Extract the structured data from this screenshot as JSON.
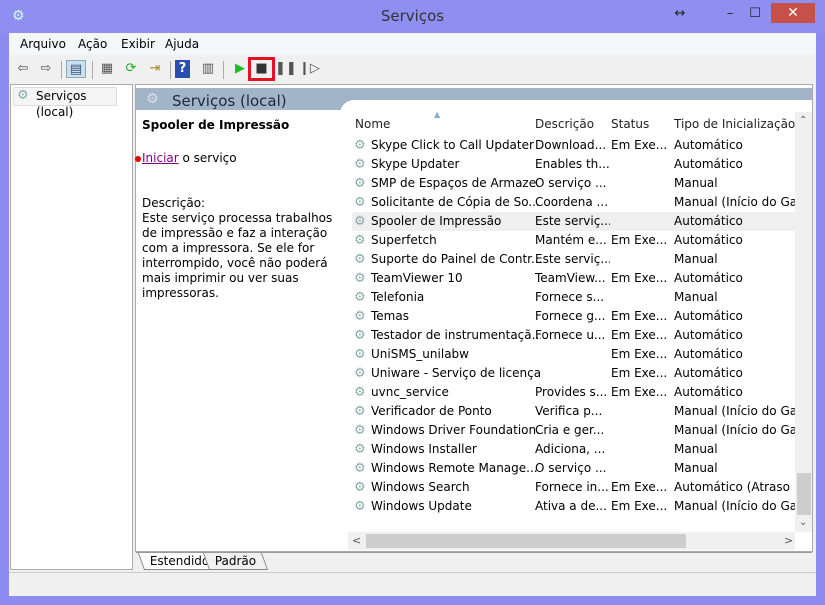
{
  "window": {
    "title": "Serviços",
    "resize_icon": "↔",
    "minimize": "–",
    "maximize": "☐",
    "close": "✕"
  },
  "menu": [
    "Arquivo",
    "Ação",
    "Exibir",
    "Ajuda"
  ],
  "toolbar": {
    "buttons": [
      "back-arrow-icon",
      "forward-arrow-icon",
      "show-hide-console-tree-icon",
      "properties-icon",
      "refresh-icon",
      "export-list-icon",
      "help-icon",
      "action-pane-icon",
      "start-service-icon",
      "stop-service-icon",
      "pause-service-icon",
      "resume-service-icon"
    ],
    "highlight_color": "#e81123"
  },
  "tree": {
    "root": "Serviços (local)"
  },
  "pane": {
    "title": "Serviços (local)"
  },
  "detail": {
    "service_name": "Spooler de Impressão",
    "start_link": "Iniciar",
    "start_suffix": " o serviço",
    "desc_label": "Descrição:",
    "desc_text": "Este serviço processa trabalhos de impressão e faz a interação com a impressora. Se ele for interrompido, você não poderá mais imprimir ou ver suas impressoras."
  },
  "columns": [
    "Nome",
    "Descrição",
    "Status",
    "Tipo de Inicialização"
  ],
  "selected_index": 4,
  "rows": [
    [
      "Skype Click to Call Updater",
      "Download...",
      "Em Exe...",
      "Automático"
    ],
    [
      "Skype Updater",
      "Enables th...",
      "",
      "Automático"
    ],
    [
      "SMP de Espaços de Armaze...",
      "O serviço ...",
      "",
      "Manual"
    ],
    [
      "Solicitante de Cópia de So...",
      "Coordena ...",
      "",
      "Manual (Início do Ga..."
    ],
    [
      "Spooler de Impressão",
      "Este serviç...",
      "",
      "Automático"
    ],
    [
      "Superfetch",
      "Mantém e...",
      "Em Exe...",
      "Automático"
    ],
    [
      "Suporte do Painel de Contr...",
      "Este serviç...",
      "",
      "Manual"
    ],
    [
      "TeamViewer 10",
      "TeamView...",
      "Em Exe...",
      "Automático"
    ],
    [
      "Telefonia",
      "Fornece s...",
      "",
      "Manual"
    ],
    [
      "Temas",
      "Fornece g...",
      "Em Exe...",
      "Automático"
    ],
    [
      "Testador de instrumentaçã...",
      "Fornece u...",
      "Em Exe...",
      "Automático"
    ],
    [
      "UniSMS_unilabw",
      "",
      "Em Exe...",
      "Automático"
    ],
    [
      "Uniware - Serviço de licenças",
      "",
      "Em Exe...",
      "Automático"
    ],
    [
      "uvnc_service",
      "Provides s...",
      "Em Exe...",
      "Automático"
    ],
    [
      "Verificador de Ponto",
      "Verifica p...",
      "",
      "Manual (Início do Ga..."
    ],
    [
      "Windows Driver Foundation...",
      "Cria e ger...",
      "",
      "Manual (Início do Ga..."
    ],
    [
      "Windows Installer",
      "Adiciona, ...",
      "",
      "Manual"
    ],
    [
      "Windows Remote Manage...",
      "O serviço ...",
      "",
      "Manual"
    ],
    [
      "Windows Search",
      "Fornece in...",
      "Em Exe...",
      "Automático (Atraso ..."
    ],
    [
      "Windows Update",
      "Ativa a de...",
      "Em Exe...",
      "Manual (Início do Ga..."
    ]
  ],
  "tabs": [
    "Estendido",
    "Padrão"
  ]
}
